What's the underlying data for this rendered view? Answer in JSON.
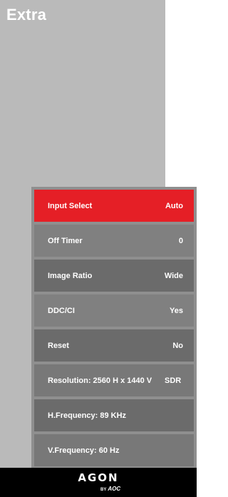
{
  "page": {
    "title": "Extra"
  },
  "menu": {
    "items": [
      {
        "label": "Input Select",
        "value": "Auto",
        "selected": true
      },
      {
        "label": "Off Timer",
        "value": "0"
      },
      {
        "label": "Image Ratio",
        "value": "Wide"
      },
      {
        "label": "DDC/CI",
        "value": "Yes"
      },
      {
        "label": "Reset",
        "value": "No"
      }
    ],
    "info": {
      "resolution": "Resolution: 2560 H x 1440 V",
      "hdr_mode": "SDR",
      "hfrequency": "H.Frequency: 89 KHz",
      "vfrequency": "V.Frequency: 60 Hz"
    }
  },
  "footer": {
    "brand": "AGON",
    "by": "BY",
    "maker": "AOC"
  },
  "colors": {
    "panel": "#bababa",
    "selected": "#e51f26",
    "footer": "#000000"
  }
}
